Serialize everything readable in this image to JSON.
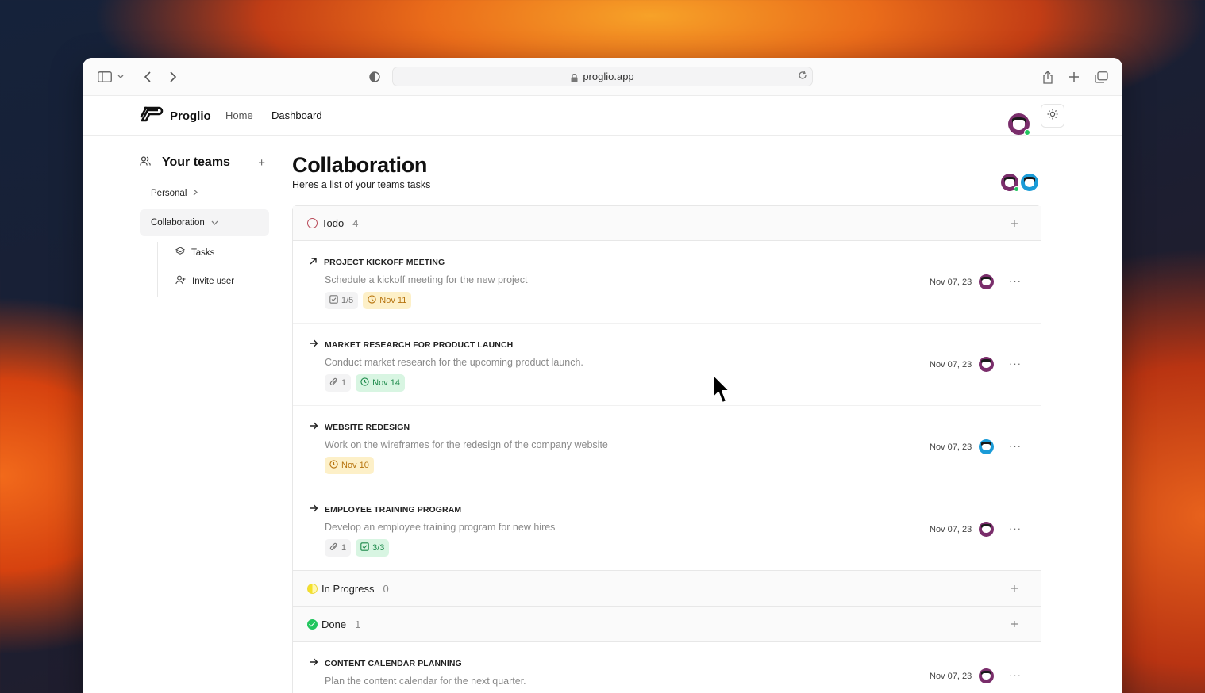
{
  "browser": {
    "url": "proglio.app"
  },
  "app": {
    "brand": "Proglio",
    "nav": {
      "home": "Home",
      "dashboard": "Dashboard"
    }
  },
  "sidebar": {
    "title": "Your teams",
    "add": "+",
    "items": {
      "personal": "Personal",
      "collaboration": "Collaboration",
      "tasks": "Tasks",
      "invite": "Invite user"
    }
  },
  "page": {
    "title": "Collaboration",
    "subtitle": "Heres a list of your teams tasks"
  },
  "groups": {
    "todo": {
      "label": "Todo",
      "count": "4"
    },
    "in_progress": {
      "label": "In Progress",
      "count": "0"
    },
    "done": {
      "label": "Done",
      "count": "1"
    }
  },
  "tasks": [
    {
      "title": "PROJECT KICKOFF MEETING",
      "description": "Schedule a kickoff meeting for the new project",
      "priority_icon": "arrow-up-right-icon",
      "badges": [
        {
          "kind": "checklist",
          "text": "1/5",
          "style": "gray"
        },
        {
          "kind": "due",
          "text": "Nov 11",
          "style": "amber"
        }
      ],
      "date": "Nov 07, 23",
      "assignee": "purple"
    },
    {
      "title": "MARKET RESEARCH FOR PRODUCT LAUNCH",
      "description": "Conduct market research for the upcoming product launch.",
      "priority_icon": "arrow-right-icon",
      "badges": [
        {
          "kind": "attachment",
          "text": "1",
          "style": "gray"
        },
        {
          "kind": "due",
          "text": "Nov 14",
          "style": "green"
        }
      ],
      "date": "Nov 07, 23",
      "assignee": "purple"
    },
    {
      "title": "WEBSITE REDESIGN",
      "description": "Work on the wireframes for the redesign of the company website",
      "priority_icon": "arrow-right-icon",
      "badges": [
        {
          "kind": "due",
          "text": "Nov 10",
          "style": "amber"
        }
      ],
      "date": "Nov 07, 23",
      "assignee": "blue"
    },
    {
      "title": "EMPLOYEE TRAINING PROGRAM",
      "description": "Develop an employee training program for new hires",
      "priority_icon": "arrow-right-icon",
      "badges": [
        {
          "kind": "attachment",
          "text": "1",
          "style": "gray"
        },
        {
          "kind": "checklist",
          "text": "3/3",
          "style": "green"
        }
      ],
      "date": "Nov 07, 23",
      "assignee": "purple"
    }
  ],
  "done_tasks": [
    {
      "title": "CONTENT CALENDAR PLANNING",
      "description": "Plan the content calendar for the next quarter.",
      "date": "Nov 07, 23",
      "assignee": "purple"
    }
  ],
  "colors": {
    "accent_purple": "#7a2d6b",
    "accent_blue": "#1a9bd7",
    "todo_ring": "#b84a59",
    "done_green": "#22c55e"
  }
}
